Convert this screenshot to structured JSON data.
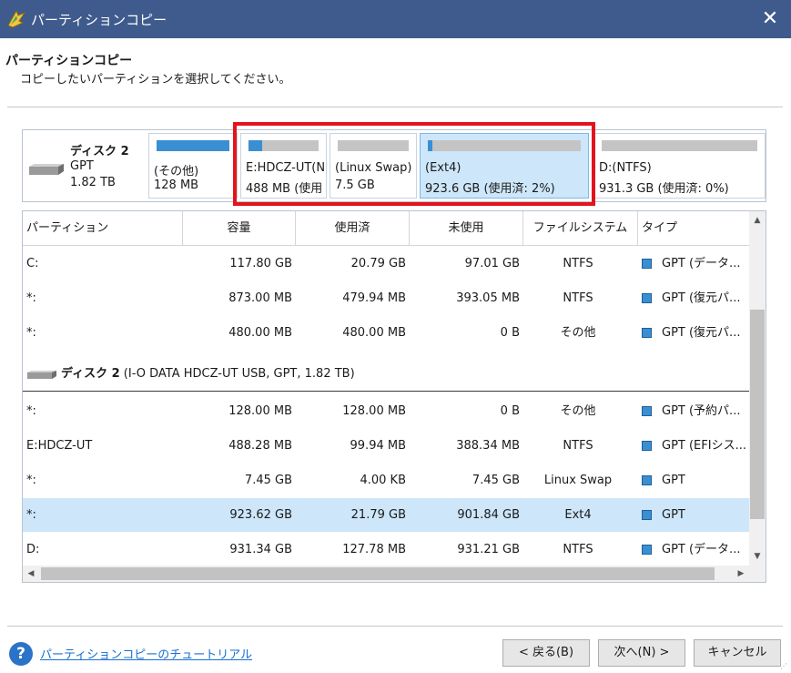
{
  "window": {
    "title": "パーティションコピー",
    "close_glyph": "✕"
  },
  "header": {
    "heading": "パーティションコピー",
    "subheading": "コピーしたいパーティションを選択してください。"
  },
  "diskmap": {
    "disk_name": "ディスク 2",
    "disk_type": "GPT",
    "disk_size": "1.82 TB",
    "partitions": [
      {
        "name": "(その他)",
        "info": "128 MB",
        "used_fraction": 1.0
      },
      {
        "name": "E:HDCZ-UT(N",
        "info": "488 MB (使用",
        "used_fraction": 0.2
      },
      {
        "name": "(Linux Swap)",
        "info": "7.5 GB",
        "used_fraction": 0.0
      },
      {
        "name": "(Ext4)",
        "info": "923.6 GB (使用済: 2%)",
        "used_fraction": 0.02
      },
      {
        "name": "D:(NTFS)",
        "info": "931.3 GB (使用済: 0%)",
        "used_fraction": 0.0
      }
    ]
  },
  "table": {
    "columns": [
      "パーティション",
      "容量",
      "使用済",
      "未使用",
      "ファイルシステム",
      "タイプ"
    ],
    "rows_top": [
      {
        "partition": "C:",
        "capacity": "117.80 GB",
        "used": "20.79 GB",
        "free": "97.01 GB",
        "fs": "NTFS",
        "type": "GPT (データ..."
      },
      {
        "partition": "*:",
        "capacity": "873.00 MB",
        "used": "479.94 MB",
        "free": "393.05 MB",
        "fs": "NTFS",
        "type": "GPT (復元パ..."
      },
      {
        "partition": "*:",
        "capacity": "480.00 MB",
        "used": "480.00 MB",
        "free": "0 B",
        "fs": "その他",
        "type": "GPT (復元パ..."
      }
    ],
    "disk2_header_bold": "ディスク 2",
    "disk2_header_rest": " (I-O DATA HDCZ-UT USB, GPT, 1.82 TB)",
    "rows_disk2": [
      {
        "partition": "*:",
        "capacity": "128.00 MB",
        "used": "128.00 MB",
        "free": "0 B",
        "fs": "その他",
        "type": "GPT (予約パ..."
      },
      {
        "partition": "E:HDCZ-UT",
        "capacity": "488.28 MB",
        "used": "99.94 MB",
        "free": "388.34 MB",
        "fs": "NTFS",
        "type": "GPT (EFIシス..."
      },
      {
        "partition": "*:",
        "capacity": "7.45 GB",
        "used": "4.00 KB",
        "free": "7.45 GB",
        "fs": "Linux Swap",
        "type": "GPT"
      },
      {
        "partition": "*:",
        "capacity": "923.62 GB",
        "used": "21.79 GB",
        "free": "901.84 GB",
        "fs": "Ext4",
        "type": "GPT"
      },
      {
        "partition": "D:",
        "capacity": "931.34 GB",
        "used": "127.78 MB",
        "free": "931.21 GB",
        "fs": "NTFS",
        "type": "GPT (データ..."
      }
    ],
    "scroll_up": "▲",
    "scroll_down": "▼",
    "scroll_left": "◀",
    "scroll_right": "▶"
  },
  "footer": {
    "help_glyph": "?",
    "help_link": "パーティションコピーのチュートリアル",
    "back": "< 戻る(B)",
    "next": "次へ(N) >",
    "cancel": "キャンセル"
  },
  "colors": {
    "titlebar": "#3f5a8c",
    "accent": "#3a8fd3",
    "selected_row": "#cde6fa",
    "highlight_frame": "#e3141c"
  }
}
